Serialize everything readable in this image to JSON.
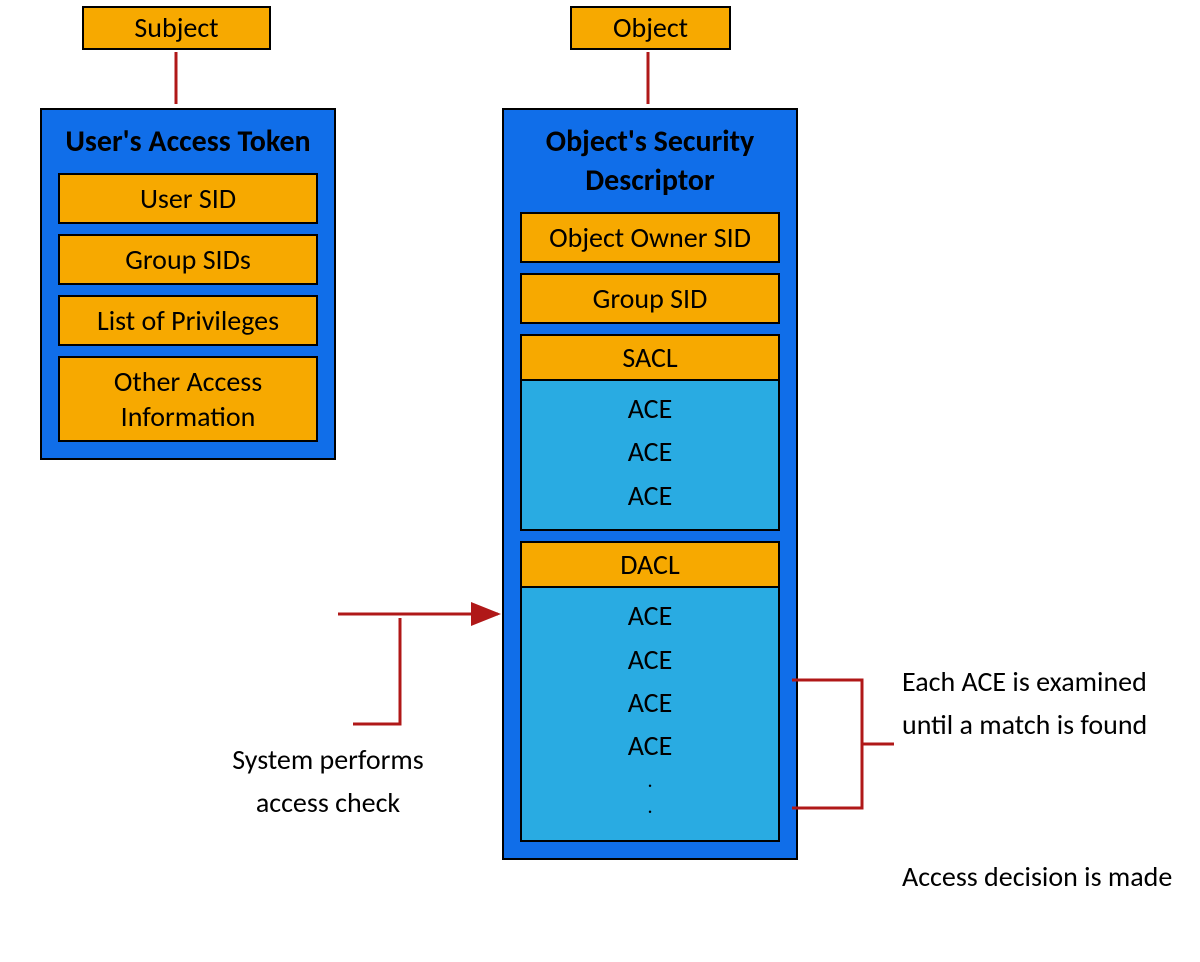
{
  "subject_label": "Subject",
  "object_label": "Object",
  "token": {
    "title": "User's Access Token",
    "items": [
      "User SID",
      "Group SIDs",
      "List of Privileges",
      "Other Access Information"
    ]
  },
  "descriptor": {
    "title": "Object's Security Descriptor",
    "owner": "Object Owner SID",
    "group": "Group SID",
    "sacl": {
      "header": "SACL",
      "entries": [
        "ACE",
        "ACE",
        "ACE"
      ]
    },
    "dacl": {
      "header": "DACL",
      "entries": [
        "ACE",
        "ACE",
        "ACE",
        "ACE",
        ".",
        "."
      ]
    }
  },
  "annotations": {
    "access_check": "System performs access check",
    "each_ace": "Each ACE is examined until a match is found",
    "decision": "Access decision is made"
  }
}
